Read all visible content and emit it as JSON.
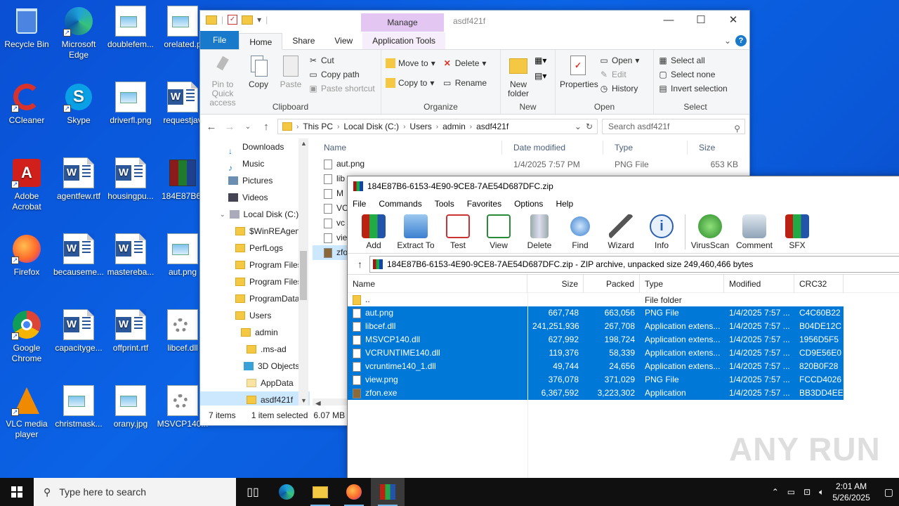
{
  "desktop": {
    "icons": [
      {
        "label": "Recycle Bin"
      },
      {
        "label": "Microsoft Edge"
      },
      {
        "label": "doublefem..."
      },
      {
        "label": "orelated.p"
      },
      {
        "label": "CCleaner"
      },
      {
        "label": "Skype"
      },
      {
        "label": "driverfl.png"
      },
      {
        "label": "requestjav"
      },
      {
        "label": "Adobe Acrobat"
      },
      {
        "label": "agentfew.rtf"
      },
      {
        "label": "housingpu..."
      },
      {
        "label": "184E87B6-"
      },
      {
        "label": "Firefox"
      },
      {
        "label": "becauseme..."
      },
      {
        "label": "mastereba..."
      },
      {
        "label": "aut.png"
      },
      {
        "label": "Google Chrome"
      },
      {
        "label": "capacityge..."
      },
      {
        "label": "offprint.rtf"
      },
      {
        "label": "libcef.dll"
      },
      {
        "label": "VLC media player"
      },
      {
        "label": "christmask..."
      },
      {
        "label": "orany.jpg"
      },
      {
        "label": "MSVCP140..."
      }
    ]
  },
  "explorer": {
    "title": "asdf421f",
    "contextual_tab": "Manage",
    "tabs": [
      "File",
      "Home",
      "Share",
      "View",
      "Application Tools"
    ],
    "ribbon": {
      "clipboard": {
        "name": "Clipboard",
        "pin": "Pin to Quick access",
        "copy": "Copy",
        "paste": "Paste",
        "cut": "Cut",
        "copy_path": "Copy path",
        "paste_shortcut": "Paste shortcut"
      },
      "organize": {
        "name": "Organize",
        "move_to": "Move to",
        "copy_to": "Copy to",
        "delete": "Delete",
        "rename": "Rename"
      },
      "new": {
        "name": "New",
        "new_folder": "New folder"
      },
      "open": {
        "name": "Open",
        "properties": "Properties",
        "open": "Open",
        "edit": "Edit",
        "history": "History"
      },
      "select": {
        "name": "Select",
        "select_all": "Select all",
        "select_none": "Select none",
        "invert": "Invert selection"
      }
    },
    "breadcrumb": [
      "This PC",
      "Local Disk (C:)",
      "Users",
      "admin",
      "asdf421f"
    ],
    "search_placeholder": "Search asdf421f",
    "nav": [
      {
        "label": "Downloads"
      },
      {
        "label": "Music"
      },
      {
        "label": "Pictures"
      },
      {
        "label": "Videos"
      },
      {
        "label": "Local Disk (C:)"
      },
      {
        "label": "$WinREAgent"
      },
      {
        "label": "PerfLogs"
      },
      {
        "label": "Program Files"
      },
      {
        "label": "Program Files"
      },
      {
        "label": "ProgramData"
      },
      {
        "label": "Users"
      },
      {
        "label": "admin"
      },
      {
        "label": ".ms-ad"
      },
      {
        "label": "3D Objects"
      },
      {
        "label": "AppData"
      },
      {
        "label": "asdf421f"
      }
    ],
    "columns": [
      "Name",
      "Date modified",
      "Type",
      "Size"
    ],
    "files": [
      {
        "name": "aut.png",
        "date": "1/4/2025 7:57 PM",
        "type": "PNG File",
        "size": "653 KB"
      },
      {
        "name": "lib",
        "date": "",
        "type": "",
        "size": ""
      },
      {
        "name": "M",
        "date": "",
        "type": "",
        "size": ""
      },
      {
        "name": "VC",
        "date": "",
        "type": "",
        "size": ""
      },
      {
        "name": "vc",
        "date": "",
        "type": "",
        "size": ""
      },
      {
        "name": "vie",
        "date": "",
        "type": "",
        "size": ""
      },
      {
        "name": "zfo",
        "date": "",
        "type": "",
        "size": ""
      }
    ],
    "status": {
      "count": "7 items",
      "selected": "1 item selected",
      "size": "6.07 MB"
    }
  },
  "winrar": {
    "title": "184E87B6-6153-4E90-9CE8-7AE54D687DFC.zip",
    "menu": [
      "File",
      "Commands",
      "Tools",
      "Favorites",
      "Options",
      "Help"
    ],
    "toolbar": [
      "Add",
      "Extract To",
      "Test",
      "View",
      "Delete",
      "Find",
      "Wizard",
      "Info",
      "VirusScan",
      "Comment",
      "SFX"
    ],
    "path": "184E87B6-6153-4E90-9CE8-7AE54D687DFC.zip - ZIP archive, unpacked size 249,460,466 bytes",
    "columns": [
      "Name",
      "Size",
      "Packed",
      "Type",
      "Modified",
      "CRC32"
    ],
    "rows": [
      {
        "name": "..",
        "size": "",
        "packed": "",
        "type": "File folder",
        "modified": "",
        "crc": ""
      },
      {
        "name": "aut.png",
        "size": "667,748",
        "packed": "663,056",
        "type": "PNG File",
        "modified": "1/4/2025 7:57 ...",
        "crc": "C4C60B22"
      },
      {
        "name": "libcef.dll",
        "size": "241,251,936",
        "packed": "267,708",
        "type": "Application extens...",
        "modified": "1/4/2025 7:57 ...",
        "crc": "B04DE12C"
      },
      {
        "name": "MSVCP140.dll",
        "size": "627,992",
        "packed": "198,724",
        "type": "Application extens...",
        "modified": "1/4/2025 7:57 ...",
        "crc": "1956D5F5"
      },
      {
        "name": "VCRUNTIME140.dll",
        "size": "119,376",
        "packed": "58,339",
        "type": "Application extens...",
        "modified": "1/4/2025 7:57 ...",
        "crc": "CD9E56E0"
      },
      {
        "name": "vcruntime140_1.dll",
        "size": "49,744",
        "packed": "24,656",
        "type": "Application extens...",
        "modified": "1/4/2025 7:57 ...",
        "crc": "820B0F28"
      },
      {
        "name": "view.png",
        "size": "376,078",
        "packed": "371,029",
        "type": "PNG File",
        "modified": "1/4/2025 7:57 ...",
        "crc": "FCCD4026"
      },
      {
        "name": "zfon.exe",
        "size": "6,367,592",
        "packed": "3,223,302",
        "type": "Application",
        "modified": "1/4/2025 7:57 ...",
        "crc": "BB3DD4EE"
      }
    ]
  },
  "taskbar": {
    "search_placeholder": "Type here to search",
    "time": "2:01 AM",
    "date": "5/26/2025"
  },
  "watermark": "ANY RUN"
}
